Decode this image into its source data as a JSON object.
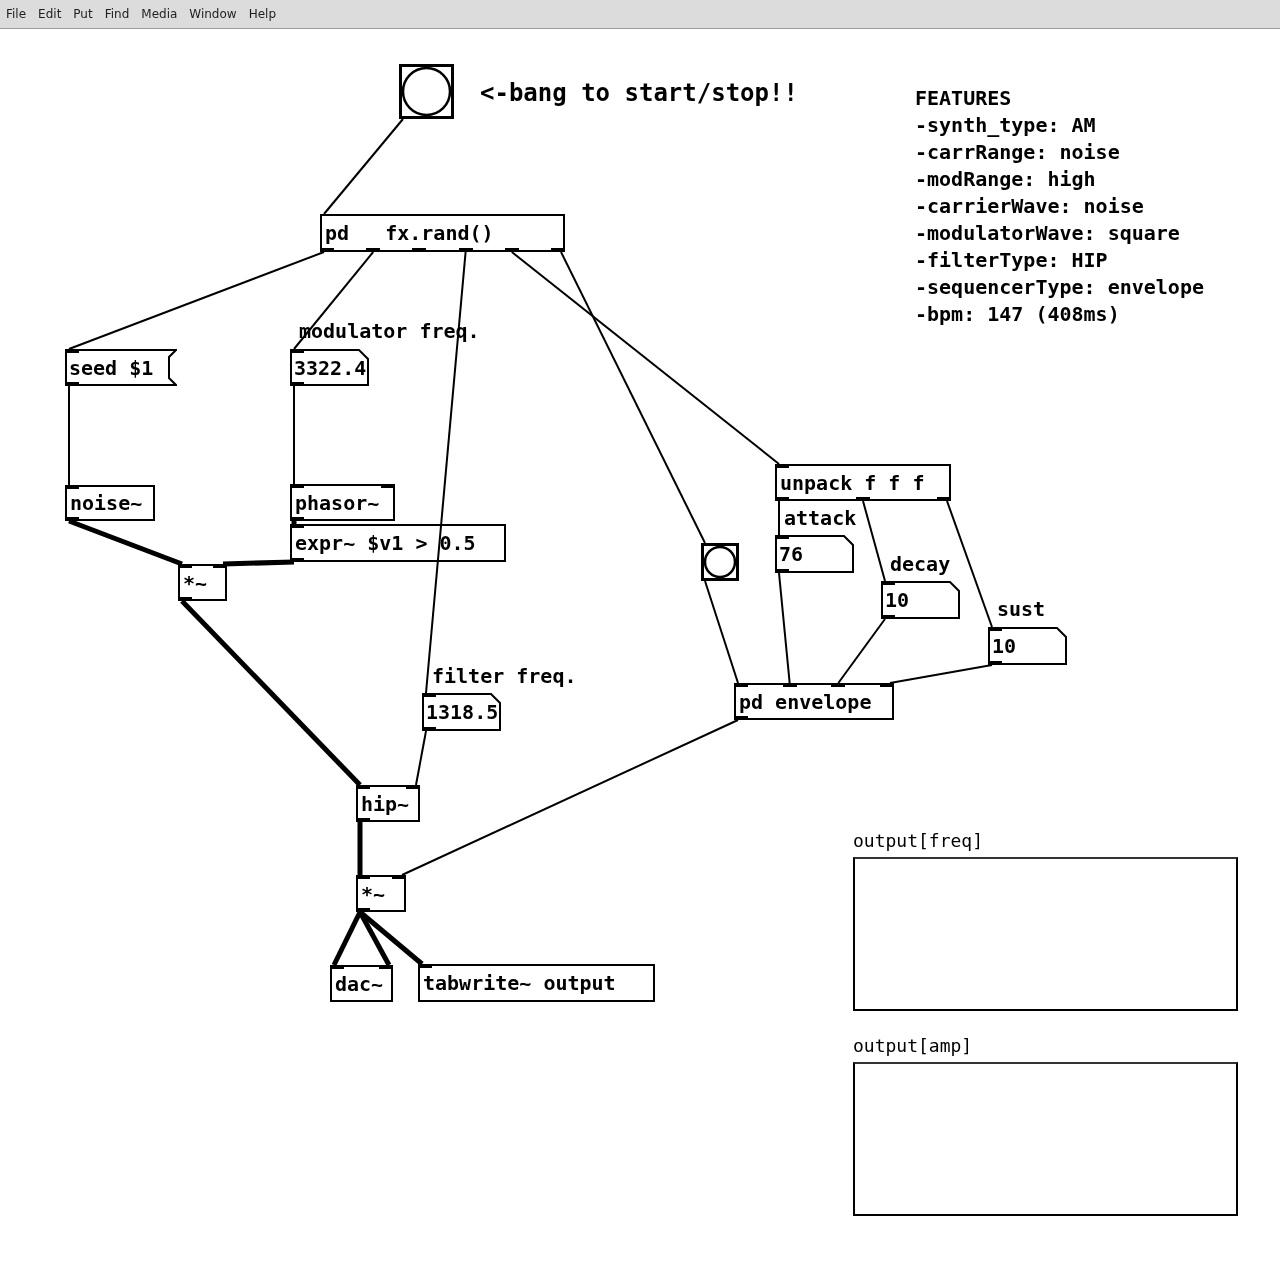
{
  "menu": [
    "File",
    "Edit",
    "Put",
    "Find",
    "Media",
    "Window",
    "Help"
  ],
  "patch": {
    "nodes": [
      {
        "kind": "bang"
      },
      {
        "kind": "comment",
        "text": "<-bang to start/stop!!"
      },
      {
        "kind": "comment_block",
        "title": "FEATURES",
        "lines": [
          "-synth_type: AM",
          "-carrRange: noise",
          "-modRange: high",
          "-carrierWave: noise",
          "-modulatorWave: square",
          "-filterType: HIP",
          "-sequencerType: envelope",
          "-bpm: 147 (408ms)"
        ]
      },
      {
        "kind": "object",
        "text": "pd   fx.rand()"
      },
      {
        "kind": "comment",
        "text": "modulator freq."
      },
      {
        "kind": "message",
        "text": "seed $1"
      },
      {
        "kind": "number",
        "value": "3322.4"
      },
      {
        "kind": "object",
        "text": "noise~"
      },
      {
        "kind": "object",
        "text": "phasor~"
      },
      {
        "kind": "object",
        "text": "expr~ $v1 > 0.5"
      },
      {
        "kind": "object",
        "text": "*~"
      },
      {
        "kind": "comment",
        "text": "filter freq."
      },
      {
        "kind": "number",
        "value": "1318.5"
      },
      {
        "kind": "bang"
      },
      {
        "kind": "object",
        "text": "unpack f f f"
      },
      {
        "kind": "comment",
        "text": "attack"
      },
      {
        "kind": "number",
        "value": "76"
      },
      {
        "kind": "comment",
        "text": "decay"
      },
      {
        "kind": "number",
        "value": "10"
      },
      {
        "kind": "comment",
        "text": "sust"
      },
      {
        "kind": "number",
        "value": "10"
      },
      {
        "kind": "object",
        "text": "pd envelope"
      },
      {
        "kind": "object",
        "text": "hip~"
      },
      {
        "kind": "object",
        "text": "*~"
      },
      {
        "kind": "object",
        "text": "dac~"
      },
      {
        "kind": "object",
        "text": "tabwrite~ output"
      },
      {
        "kind": "array",
        "label": "output[freq]"
      },
      {
        "kind": "array",
        "label": "output[amp]"
      }
    ],
    "cords": [
      {
        "signal": false
      },
      {
        "signal": false
      },
      {
        "signal": false
      },
      {
        "signal": false
      },
      {
        "signal": false
      },
      {
        "signal": false
      },
      {
        "signal": false
      },
      {
        "signal": false
      },
      {
        "signal": true
      },
      {
        "signal": true
      },
      {
        "signal": true
      },
      {
        "signal": true
      },
      {
        "signal": false
      },
      {
        "signal": true
      },
      {
        "signal": false
      },
      {
        "signal": true
      },
      {
        "signal": true
      },
      {
        "signal": true
      },
      {
        "signal": false
      },
      {
        "signal": false
      },
      {
        "signal": false
      },
      {
        "signal": false
      },
      {
        "signal": false
      },
      {
        "signal": false
      },
      {
        "signal": false
      }
    ]
  }
}
